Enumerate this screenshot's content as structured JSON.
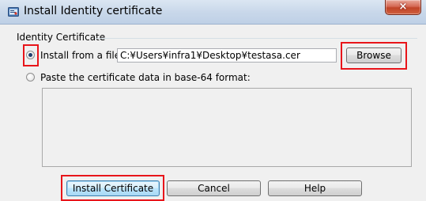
{
  "window": {
    "title": "Install Identity certificate",
    "close_label": "×"
  },
  "group": {
    "label": "Identity Certificate"
  },
  "options": {
    "install_from_file_label": "Install from a file:",
    "install_from_file_selected": true,
    "file_path": "C:¥Users¥infra1¥Desktop¥testasa.cer",
    "paste_label": "Paste the certificate data in base-64 format:",
    "paste_selected": false,
    "paste_value": ""
  },
  "buttons": {
    "browse": "Browse",
    "install": "Install Certificate",
    "cancel": "Cancel",
    "help": "Help"
  },
  "colors": {
    "highlight": "#e8151a"
  }
}
